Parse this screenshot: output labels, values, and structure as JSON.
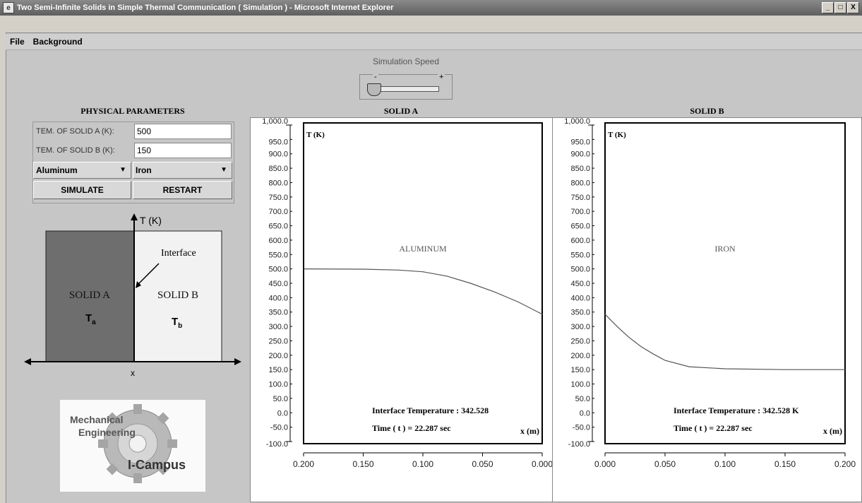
{
  "window": {
    "title": "Two Semi-Infinite Solids in Simple Thermal Communication ( Simulation ) - Microsoft Internet Explorer",
    "buttons": [
      "_",
      "□",
      "X"
    ]
  },
  "menu": {
    "file": "File",
    "background": "Background"
  },
  "speed": {
    "label": "Simulation Speed",
    "minus": "-",
    "plus": "+",
    "level": 0.05
  },
  "params": {
    "heading": "PHYSICAL PARAMETERS",
    "temp_a_label": "TEM. OF SOLID A (K):",
    "temp_a_value": "500",
    "temp_b_label": "TEM. OF SOLID B (K):",
    "temp_b_value": "150",
    "material_a": "Aluminum",
    "material_b": "Iron",
    "simulate": "SIMULATE",
    "restart": "RESTART"
  },
  "diagram": {
    "y_axis": "T (K)",
    "x_axis": "x",
    "interface": "Interface",
    "solid_a": "SOLID A",
    "solid_b": "SOLID B",
    "ta": "T",
    "ta_sub": "a",
    "tb": "T",
    "tb_sub": "b"
  },
  "logo": {
    "line1": "Mechanical",
    "line2": "Engineering",
    "line3": "I-Campus"
  },
  "colors": {
    "solid_a": "#6e6e6e",
    "solid_b": "#f2f2f2",
    "background": "#c6c6c6"
  },
  "chart_data": [
    {
      "type": "line",
      "title": "SOLID A",
      "ylabel": "T (K)",
      "xlabel": "x (m)",
      "material": "ALUMINUM",
      "y_ticks": [
        "1,000.0",
        "950.0",
        "900.0",
        "850.0",
        "800.0",
        "750.0",
        "700.0",
        "650.0",
        "600.0",
        "550.0",
        "500.0",
        "450.0",
        "400.0",
        "350.0",
        "300.0",
        "250.0",
        "200.0",
        "150.0",
        "100.0",
        "50.0",
        "0.0",
        "-50.0",
        "-100.0"
      ],
      "x_ticks": [
        "0.200",
        "0.150",
        "0.100",
        "0.050",
        "0.000"
      ],
      "xlim": [
        0.2,
        0.0
      ],
      "ylim": [
        -100,
        1000
      ],
      "x": [
        0.2,
        0.15,
        0.12,
        0.1,
        0.08,
        0.06,
        0.04,
        0.02,
        0.0
      ],
      "y": [
        500,
        499,
        496,
        490,
        475,
        450,
        420,
        385,
        342.5
      ],
      "interface_text": "Interface Temperature : 342.528",
      "time_text": "Time ( t ) = 22.287 sec"
    },
    {
      "type": "line",
      "title": "SOLID B",
      "ylabel": "T (K)",
      "xlabel": "x (m)",
      "material": "IRON",
      "y_ticks": [
        "1,000.0",
        "950.0",
        "900.0",
        "850.0",
        "800.0",
        "750.0",
        "700.0",
        "650.0",
        "600.0",
        "550.0",
        "500.0",
        "450.0",
        "400.0",
        "350.0",
        "300.0",
        "250.0",
        "200.0",
        "150.0",
        "100.0",
        "50.0",
        "0.0",
        "-50.0",
        "-100.0"
      ],
      "x_ticks": [
        "0.000",
        "0.050",
        "0.100",
        "0.150",
        "0.200"
      ],
      "xlim": [
        0.0,
        0.2
      ],
      "ylim": [
        -100,
        1000
      ],
      "x": [
        0.0,
        0.01,
        0.02,
        0.03,
        0.04,
        0.05,
        0.07,
        0.1,
        0.15,
        0.2
      ],
      "y": [
        342.5,
        300,
        262,
        230,
        205,
        182,
        160,
        153,
        150,
        150
      ],
      "interface_text": "Interface Temperature : 342.528 K",
      "time_text": "Time ( t ) = 22.287 sec"
    }
  ]
}
